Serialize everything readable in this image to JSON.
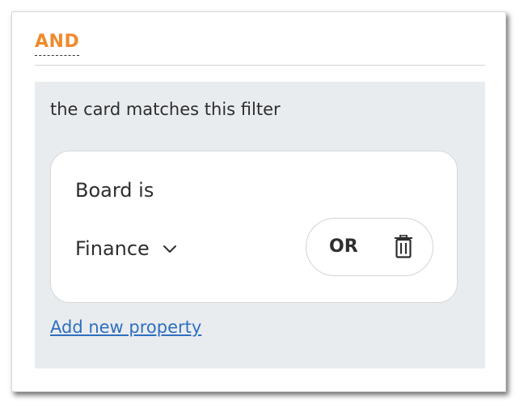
{
  "header": {
    "operator_label": "AND"
  },
  "group": {
    "title": "the card matches this filter",
    "filter": {
      "property_label": "Board is",
      "value": "Finance",
      "or_label": "OR"
    },
    "add_property_link": "Add new property"
  },
  "colors": {
    "accent": "#ef8a2c",
    "link": "#2f6fc0",
    "group_background": "#e9ecef"
  },
  "icons": [
    "chevron-down-icon",
    "trash-icon"
  ]
}
